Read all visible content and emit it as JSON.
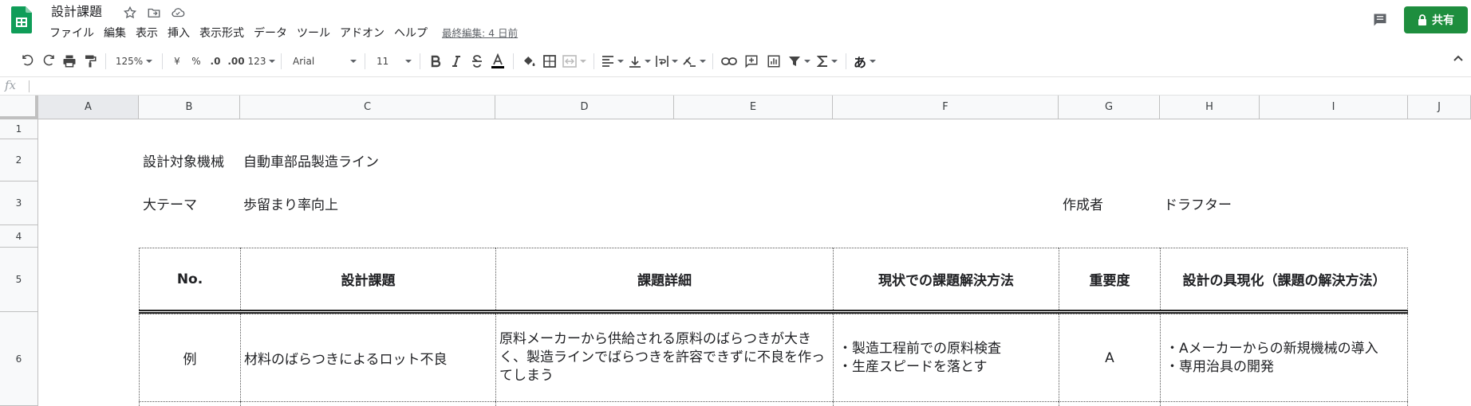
{
  "app": {
    "doc_title": "設計課題",
    "last_edit": "最終編集: 4 日前",
    "share_label": "共有"
  },
  "menu": [
    "ファイル",
    "編集",
    "表示",
    "挿入",
    "表示形式",
    "データ",
    "ツール",
    "アドオン",
    "ヘルプ"
  ],
  "toolbar": {
    "zoom": "125%",
    "currency": "¥",
    "percent": "%",
    "decimal_less": ".0",
    "decimal_more": ".00",
    "more_formats": "123",
    "font": "Arial",
    "font_size": "11",
    "input_tool": "あ"
  },
  "formula": {
    "fx": "fx",
    "value": ""
  },
  "columns": [
    "A",
    "B",
    "C",
    "D",
    "E",
    "F",
    "G",
    "H",
    "I",
    "J"
  ],
  "rows": [
    "1",
    "2",
    "3",
    "4",
    "5",
    "6"
  ],
  "sheet": {
    "b2": "設計対象機械",
    "c2": "自動車部品製造ライン",
    "b3": "大テーマ",
    "c3": "歩留まり率向上",
    "g3": "作成者",
    "h3": "ドラフター"
  },
  "table": {
    "headers": [
      "No.",
      "設計課題",
      "課題詳細",
      "現状での課題解決方法",
      "重要度",
      "設計の具現化（課題の解決方法）"
    ],
    "row1": {
      "no": "例",
      "issue": "材料のばらつきによるロット不良",
      "detail": "原料メーカーから供給される原料のばらつきが大きく、製造ラインでばらつきを許容できずに不良を作ってしまう",
      "current_1": "・製造工程前での原料検査",
      "current_2": "・生産スピードを落とす",
      "importance": "A",
      "solution_1": "・Aメーカーからの新規機械の導入",
      "solution_2": "・専用治具の開発"
    }
  },
  "colors": {
    "share_green": "#1e8e3e",
    "header_bg": "#f8f9fa",
    "gridline": "#c0c0c0"
  }
}
